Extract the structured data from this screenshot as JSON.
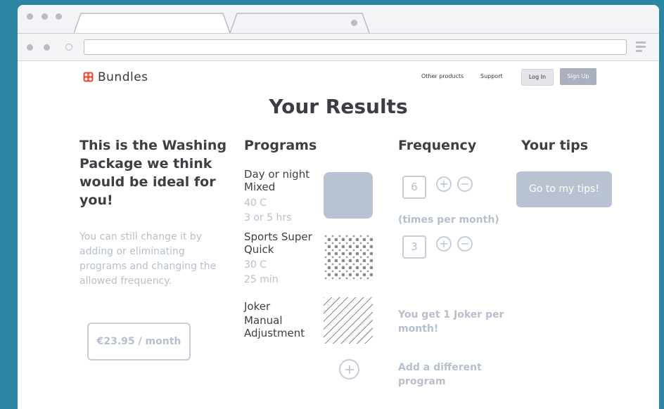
{
  "browser": {
    "url": ""
  },
  "header": {
    "brand": "Bundles",
    "nav_links": [
      "Other products",
      "Support"
    ],
    "login_label": "Log In",
    "signup_label": "Sign Up"
  },
  "page_title": "Your Results",
  "summary": {
    "heading": "This is the Washing Package we think would be ideal for you!",
    "subtext": "You can still change it by adding or eliminating programs and changing the allowed frequency.",
    "price": "€23.95 / month"
  },
  "programs": {
    "heading": "Programs",
    "items": [
      {
        "name": "Day or night Mixed",
        "temp": "40 C",
        "duration": "3 or 5 hrs"
      },
      {
        "name": "Sports Super Quick",
        "temp": "30 C",
        "duration": "25 min"
      },
      {
        "name_line1": "Joker",
        "name_line2": "Manual Adjustment"
      }
    ]
  },
  "frequency": {
    "heading": "Frequency",
    "subheading": "(times per month)",
    "values": [
      "6",
      "3"
    ],
    "plus": "+",
    "minus": "−",
    "joker_note": "You get 1 Joker per month!",
    "add_program": "Add a different program"
  },
  "tips": {
    "heading": "Your tips",
    "button": "Go to my tips!"
  },
  "colors": {
    "background": "#2a86a3",
    "brand_icon": "#e8503a",
    "muted_text": "#b6bfcc",
    "tips_button": "#b8c2d0"
  }
}
